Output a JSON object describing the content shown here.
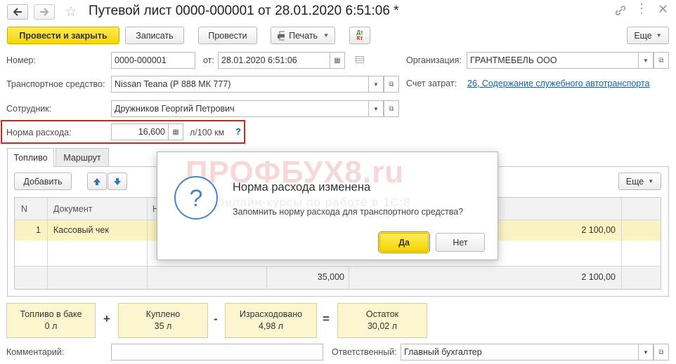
{
  "window": {
    "title": "Путевой лист 0000-000001 от 28.01.2020 6:51:06 *"
  },
  "toolbar": {
    "post_close": "Провести и закрыть",
    "save": "Записать",
    "post": "Провести",
    "print": "Печать",
    "dtkt_top": "Дт",
    "dtkt_bottom": "Кт",
    "more": "Еще"
  },
  "form": {
    "number_label": "Номер:",
    "number_value": "0000-000001",
    "from_label": "от:",
    "date_value": "28.01.2020  6:51:06",
    "org_label": "Организация:",
    "org_value": "ГРАНТМЕБЕЛЬ ООО",
    "vehicle_label": "Транспортное средство:",
    "vehicle_value": "Nissan Teana (Р 888 МК 777)",
    "cost_account_label": "Счет затрат:",
    "cost_account_value": "26, Содержание служебного автотранспорта",
    "employee_label": "Сотрудник:",
    "employee_value": "Дружников Георгий Петрович",
    "rate_label": "Норма расхода:",
    "rate_value": "16,600",
    "rate_unit": "л/100 км",
    "help": "?"
  },
  "tabs": [
    {
      "label": "Топливо"
    },
    {
      "label": "Маршрут"
    }
  ],
  "tab_toolbar": {
    "add": "Добавить",
    "more": "Еще"
  },
  "table": {
    "headers": {
      "n": "N",
      "document": "Документ",
      "col3": "Н"
    },
    "rows": [
      {
        "n": "1",
        "document": "Кассовый чек",
        "amount": "2 100,00"
      }
    ],
    "footer": {
      "qty": "35,000",
      "amount": "2 100,00"
    }
  },
  "dialog": {
    "title": "Норма расхода изменена",
    "message": "Запомнить норму расхода для транспортного средства?",
    "yes": "Да",
    "no": "Нет",
    "watermark_title": "ПРОФБУХ8.ru",
    "watermark_subtitle": "Онлайн-курсы по работе в 1С:8"
  },
  "summary": {
    "tank_label": "Топливо в баке",
    "tank_value": "0 л",
    "plus": "+",
    "bought_label": "Куплено",
    "bought_value": "35 л",
    "minus": "-",
    "spent_label": "Израсходовано",
    "spent_value": "4,98 л",
    "equals": "=",
    "rest_label": "Остаток",
    "rest_value": "30,02 л"
  },
  "footer": {
    "comment_label": "Комментарий:",
    "comment_value": "",
    "responsible_label": "Ответственный:",
    "responsible_value": "Главный бухгалтер"
  },
  "colors": {
    "accent_yellow": "#f6d500",
    "highlight_red": "#e0201b",
    "link": "#1a5e9c",
    "summary_bg": "#fbf6cf",
    "row_selected": "#fbf3c4"
  }
}
